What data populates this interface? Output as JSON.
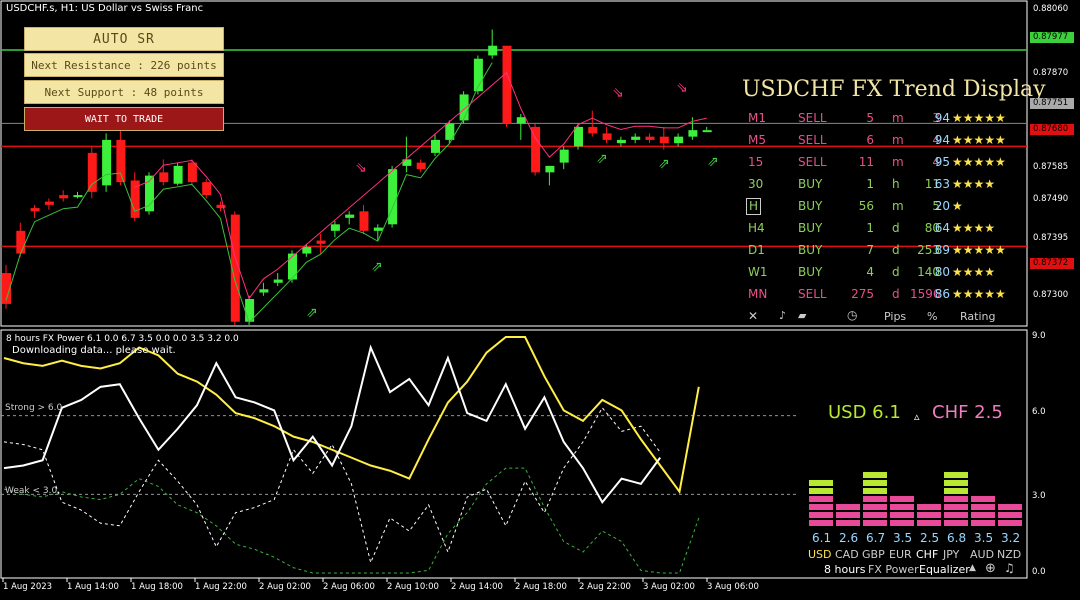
{
  "chart_header": "USDCHF.s, H1:  US Dollar vs Swiss Franc",
  "buttons": {
    "title": "AUTO SR",
    "resistance": "Next Resistance : 226 points",
    "support": "Next Support : 48 points",
    "status": "WAIT TO TRADE"
  },
  "price_axis": [
    "0.88060",
    "0.87977",
    "0.87870",
    "0.87751",
    "0.87680",
    "0.87585",
    "0.87490",
    "0.87395",
    "0.87372",
    "0.87300",
    "0.87205"
  ],
  "trend_display": {
    "title": "USDCHF FX Trend Display",
    "rows": [
      {
        "tf": "M1",
        "signal": "SELL",
        "dur": "5",
        "unit": "m",
        "pips": "3",
        "pct": "94",
        "stars": "★★★★★",
        "color": "#e8508a"
      },
      {
        "tf": "M5",
        "signal": "SELL",
        "dur": "6",
        "unit": "m",
        "pips": "4",
        "pct": "94",
        "stars": "★★★★★",
        "color": "#e8508a"
      },
      {
        "tf": "15",
        "signal": "SELL",
        "dur": "11",
        "unit": "m",
        "pips": "4",
        "pct": "95",
        "stars": "★★★★★",
        "color": "#e8508a"
      },
      {
        "tf": "30",
        "signal": "BUY",
        "dur": "1",
        "unit": "h",
        "pips": "11",
        "pct": "63",
        "stars": "★★★★",
        "color": "#8ed05a"
      },
      {
        "tf": "H",
        "signal": "BUY",
        "dur": "56",
        "unit": "m",
        "pips": "5",
        "pct": "20",
        "stars": "★",
        "color": "#8ed05a"
      },
      {
        "tf": "H4",
        "signal": "BUY",
        "dur": "1",
        "unit": "d",
        "pips": "80",
        "pct": "64",
        "stars": "★★★★",
        "color": "#8ed05a"
      },
      {
        "tf": "D1",
        "signal": "BUY",
        "dur": "7",
        "unit": "d",
        "pips": "253",
        "pct": "89",
        "stars": "★★★★★",
        "color": "#8ed05a"
      },
      {
        "tf": "W1",
        "signal": "BUY",
        "dur": "4",
        "unit": "d",
        "pips": "140",
        "pct": "80",
        "stars": "★★★★",
        "color": "#8ed05a"
      },
      {
        "tf": "MN",
        "signal": "SELL",
        "dur": "275",
        "unit": "d",
        "pips": "1596",
        "pct": "86",
        "stars": "★★★★★",
        "color": "#e8508a"
      }
    ],
    "footer": {
      "close": "✕",
      "pips": "Pips",
      "pct": "%",
      "rating": "Rating"
    }
  },
  "fx_power": {
    "header": "8 hours FX Power 6.1 0.0 6.7 3.5 0.0 0.0 3.5 3.2 0.0",
    "status": "Downloading data... please wait.",
    "strong_label": "Strong > 6.0",
    "weak_label": "Weak < 3.0",
    "pair_base": "USD 6.1",
    "pair_quote": "CHF 2.5",
    "delta_symbol": "▵",
    "axis": [
      "9.0",
      "6.0",
      "3.0",
      "0.0"
    ],
    "equalizer": [
      {
        "cur": "USD",
        "val": "6.1",
        "level": 6.1,
        "color": "#b8e830"
      },
      {
        "cur": "CAD",
        "val": "2.6",
        "level": 2.6,
        "color": "#e84a9a"
      },
      {
        "cur": "GBP",
        "val": "6.7",
        "level": 6.7,
        "color": "#b8e830"
      },
      {
        "cur": "EUR",
        "val": "3.5",
        "level": 3.5,
        "color": "#e84a9a"
      },
      {
        "cur": "CHF",
        "val": "2.5",
        "level": 2.5,
        "color": "#e84a9a"
      },
      {
        "cur": "JPY",
        "val": "6.8",
        "level": 6.8,
        "color": "#b8e830"
      },
      {
        "cur": "AUD",
        "val": "3.5",
        "level": 3.5,
        "color": "#e84a9a"
      },
      {
        "cur": "NZD",
        "val": "3.2",
        "level": 3.2,
        "color": "#e84a9a"
      }
    ],
    "eq_footer": {
      "period": "8 hours",
      "label1": "FX Power",
      "label2": "Equalizer"
    }
  },
  "time_axis": [
    "1 Aug 2023",
    "1 Aug 14:00",
    "1 Aug 18:00",
    "1 Aug 22:00",
    "2 Aug 02:00",
    "2 Aug 06:00",
    "2 Aug 10:00",
    "2 Aug 14:00",
    "2 Aug 18:00",
    "2 Aug 22:00",
    "3 Aug 02:00",
    "3 Aug 06:00"
  ],
  "chart_data": {
    "type": "candlestick",
    "candles": [
      [
        0.8729,
        0.87315,
        0.8718,
        0.87195
      ],
      [
        0.8742,
        0.87445,
        0.8734,
        0.8735
      ],
      [
        0.8749,
        0.875,
        0.8746,
        0.8748
      ],
      [
        0.8751,
        0.8752,
        0.87485,
        0.875
      ],
      [
        0.8753,
        0.87545,
        0.8751,
        0.8752
      ],
      [
        0.8753,
        0.8754,
        0.8752,
        0.8753
      ],
      [
        0.8766,
        0.8768,
        0.8752,
        0.8754
      ],
      [
        0.8756,
        0.8772,
        0.8754,
        0.877
      ],
      [
        0.877,
        0.8775,
        0.8756,
        0.8757
      ],
      [
        0.87575,
        0.876,
        0.8745,
        0.8746
      ],
      [
        0.8748,
        0.876,
        0.8747,
        0.8759
      ],
      [
        0.876,
        0.8764,
        0.8756,
        0.8757
      ],
      [
        0.87565,
        0.8763,
        0.8756,
        0.8762
      ],
      [
        0.8763,
        0.8764,
        0.8756,
        0.8757
      ],
      [
        0.8757,
        0.8758,
        0.8752,
        0.8753
      ],
      [
        0.875,
        0.8751,
        0.8748,
        0.8749
      ],
      [
        0.8747,
        0.8748,
        0.8713,
        0.8714
      ],
      [
        0.8714,
        0.8722,
        0.8713,
        0.8721
      ],
      [
        0.8723,
        0.8726,
        0.8722,
        0.8724
      ],
      [
        0.8726,
        0.8729,
        0.8725,
        0.8727
      ],
      [
        0.8727,
        0.8736,
        0.8726,
        0.8735
      ],
      [
        0.8735,
        0.8738,
        0.8734,
        0.8737
      ],
      [
        0.8739,
        0.8741,
        0.8735,
        0.8738
      ],
      [
        0.8742,
        0.8745,
        0.874,
        0.8744
      ],
      [
        0.8746,
        0.8748,
        0.8744,
        0.8747
      ],
      [
        0.8748,
        0.875,
        0.8741,
        0.8742
      ],
      [
        0.8742,
        0.8744,
        0.8739,
        0.8743
      ],
      [
        0.8744,
        0.8762,
        0.8743,
        0.8761
      ],
      [
        0.8762,
        0.8771,
        0.876,
        0.8764
      ],
      [
        0.8763,
        0.8764,
        0.876,
        0.8761
      ],
      [
        0.8766,
        0.8772,
        0.8765,
        0.877
      ],
      [
        0.877,
        0.8776,
        0.8769,
        0.8775
      ],
      [
        0.8776,
        0.8785,
        0.8775,
        0.8784
      ],
      [
        0.8785,
        0.8796,
        0.8784,
        0.8795
      ],
      [
        0.8796,
        0.8804,
        0.8795,
        0.8799
      ],
      [
        0.8799,
        0.8798,
        0.8774,
        0.8775
      ],
      [
        0.8775,
        0.8778,
        0.877,
        0.8777
      ],
      [
        0.8774,
        0.8775,
        0.8759,
        0.876
      ],
      [
        0.876,
        0.8762,
        0.8756,
        0.8762
      ],
      [
        0.8763,
        0.8768,
        0.8761,
        0.8767
      ],
      [
        0.8768,
        0.8775,
        0.8767,
        0.8774
      ],
      [
        0.8774,
        0.8779,
        0.8771,
        0.8772
      ],
      [
        0.8772,
        0.8774,
        0.8769,
        0.877
      ],
      [
        0.8769,
        0.8771,
        0.8768,
        0.877
      ],
      [
        0.877,
        0.8772,
        0.8769,
        0.8771
      ],
      [
        0.8771,
        0.8772,
        0.8769,
        0.877
      ],
      [
        0.8771,
        0.8774,
        0.8767,
        0.8769
      ],
      [
        0.8769,
        0.8772,
        0.8768,
        0.8771
      ],
      [
        0.8771,
        0.8777,
        0.877,
        0.8773
      ],
      [
        0.8773,
        0.8774,
        0.8773,
        0.8773
      ]
    ],
    "resistance": [
      0.87977
    ],
    "support": [
      0.8768,
      0.87372
    ],
    "current_price": 0.87751,
    "ylim": [
      0.8713,
      0.881
    ],
    "fx_power_series": {
      "usd": [
        8.2,
        8.0,
        7.9,
        8.1,
        7.9,
        7.8,
        8.0,
        8.6,
        8.3,
        7.6,
        7.3,
        6.8,
        6.1,
        5.9,
        5.6,
        5.2,
        5.0,
        4.7,
        4.4,
        4.1,
        3.9,
        3.6,
        5.1,
        6.5,
        7.3,
        8.4,
        9.0,
        9.0,
        7.5,
        6.2,
        5.8,
        6.6,
        6.2,
        5.1,
        4.1,
        3.1,
        7.1
      ],
      "chf": [
        4.0,
        4.1,
        4.3,
        6.3,
        6.6,
        7.1,
        7.2,
        5.9,
        4.7,
        5.5,
        6.4,
        8.0,
        6.7,
        6.5,
        6.2,
        4.3,
        5.2,
        4.1,
        5.6,
        8.6,
        6.9,
        7.4,
        6.4,
        8.2,
        6.1,
        5.8,
        7.2,
        5.5,
        6.7,
        5.0,
        4.0,
        2.7,
        3.6,
        3.4,
        4.4
      ]
    }
  }
}
